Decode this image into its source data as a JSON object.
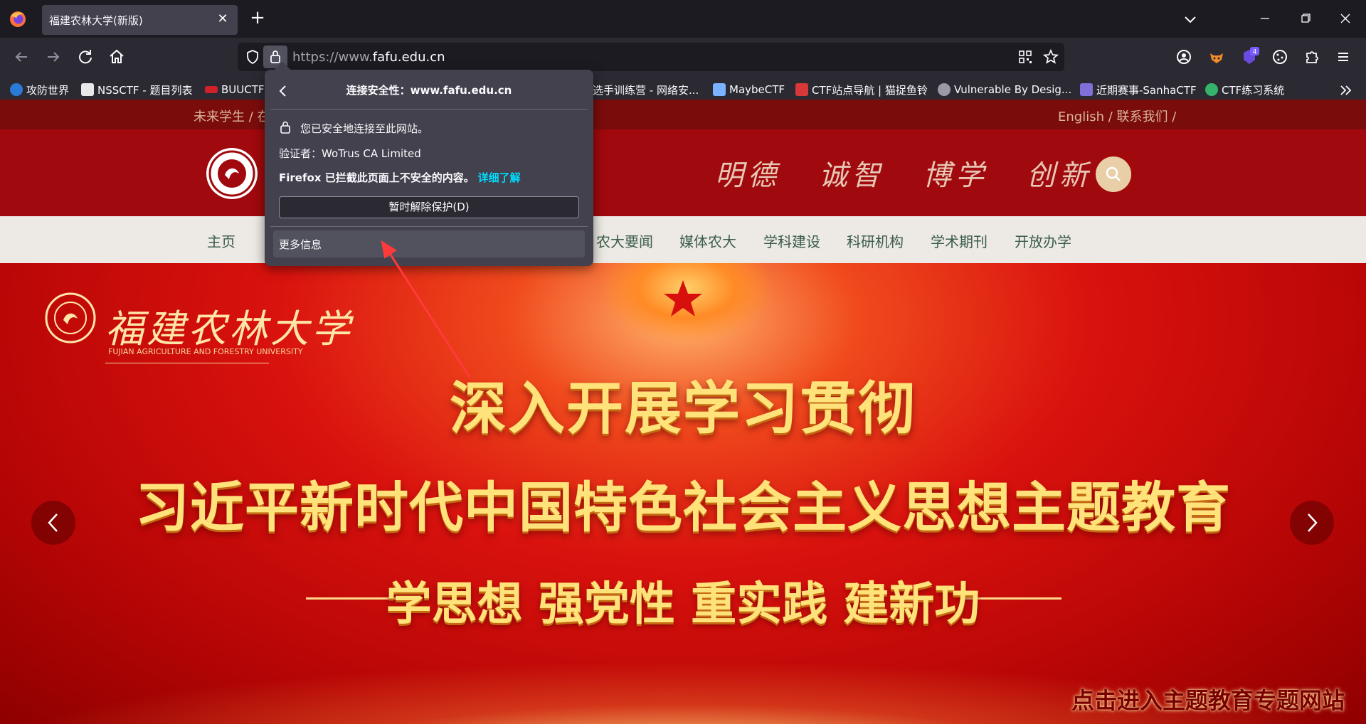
{
  "tab": {
    "title": "福建农林大学(新版)"
  },
  "urlbar": {
    "url_prefix": "https://www.",
    "url_domain": "fafu.edu.cn"
  },
  "bookmarks": [
    {
      "label": "攻防世界",
      "color": "#2b7bd6"
    },
    {
      "label": "NSSCTF - 题目列表",
      "color": "#e8e8e8"
    },
    {
      "label": "BUUCTF",
      "color": "#d0202a"
    },
    {
      "label": "选手训练营 - 网络安...",
      "color": "#3aa0e0"
    },
    {
      "label": "MaybeCTF",
      "color": "#7ab3ff"
    },
    {
      "label": "CTF站点导航 | 猫捉鱼铃",
      "color": "#d83838"
    },
    {
      "label": "Vulnerable By Desig...",
      "color": "#9a9aa6"
    },
    {
      "label": "近期赛事-SanhaCTF",
      "color": "#7f6fd8"
    },
    {
      "label": "CTF练习系统",
      "color": "#36b36b"
    }
  ],
  "extension_badge": "4",
  "page": {
    "topstrip_left": "未来学生 / 在",
    "topstrip_right": "English / 联系我们 /",
    "motto": [
      "明德",
      "诚智",
      "博学",
      "创新"
    ],
    "menu": [
      "主页",
      "农大要闻",
      "媒体农大",
      "学科建设",
      "科研机构",
      "学术期刊",
      "开放办学"
    ],
    "banner": {
      "school_name": "福建农林大学",
      "school_name_en": "FUJIAN AGRICULTURE AND FORESTRY UNIVERSITY",
      "line1": "深入开展学习贯彻",
      "line2": "习近平新时代中国特色社会主义思想主题教育",
      "line3": "学思想  强党性  重实践  建新功",
      "link": "点击进入主题教育专题网站"
    }
  },
  "popup": {
    "title": "连接安全性：www.fafu.edu.cn",
    "secure_text": "您已安全地连接至此网站。",
    "verifier": "验证者：WoTrus CA Limited",
    "blocked_prefix": "Firefox 已拦截此页面上不安全的内容。",
    "learn_more": "详细了解",
    "disable_button": "暂时解除保护(D)",
    "more_info": "更多信息"
  },
  "colors": {
    "accent_red": "#a0090d",
    "popup_bg": "#42414d",
    "link_cyan": "#00ddff"
  }
}
